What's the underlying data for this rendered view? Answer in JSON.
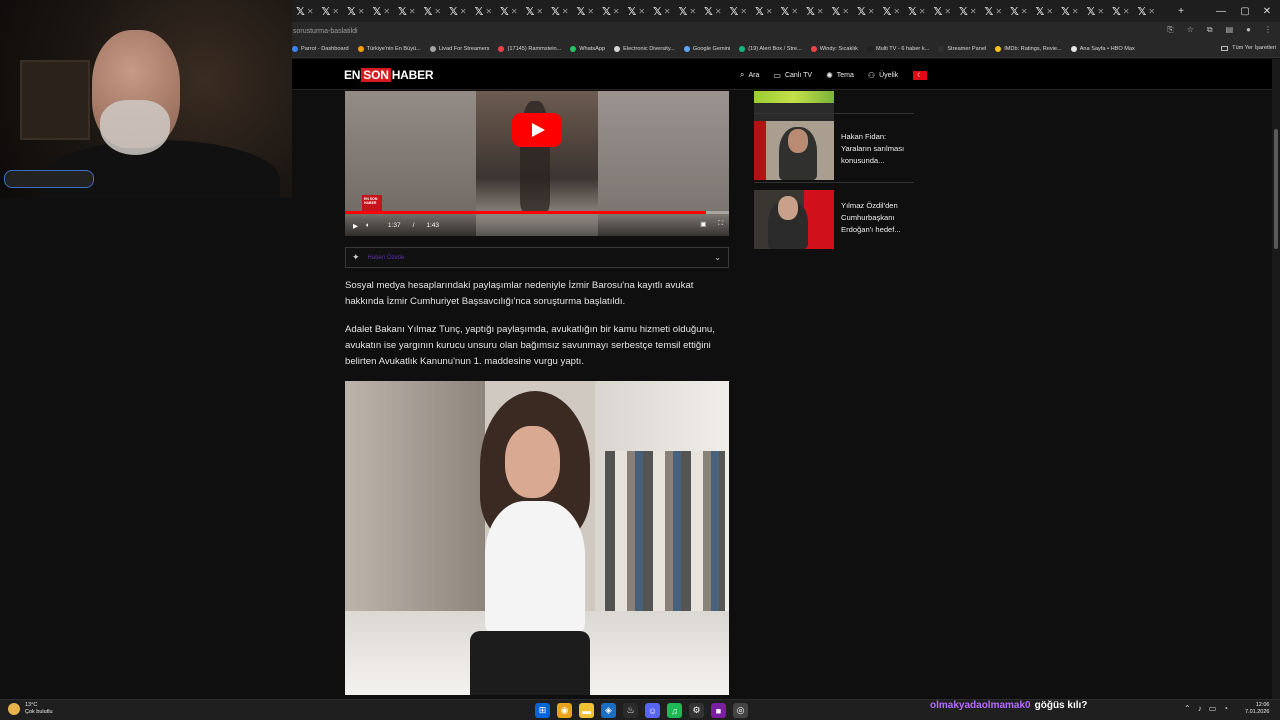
{
  "browser": {
    "tab_count": 34,
    "url_fragment": "sorusturma-baslatildi",
    "bookmarks": [
      {
        "label": "Parrot - Dashboard",
        "color": "#3b82f6"
      },
      {
        "label": "Türkiye'nin En Büyü...",
        "color": "#f59e0b"
      },
      {
        "label": "Livad For Streamers",
        "color": "#a3a3a3"
      },
      {
        "label": "(17145) Rammstein...",
        "color": "#ef4444"
      },
      {
        "label": "WhatsApp",
        "color": "#22c55e"
      },
      {
        "label": "Electronic Diversity...",
        "color": "#d4d4d4"
      },
      {
        "label": "Google Gemini",
        "color": "#60a5fa"
      },
      {
        "label": "(19) Alert Box / Stre...",
        "color": "#10b981"
      },
      {
        "label": "Windy: Sıcaklık",
        "color": "#ef4444"
      },
      {
        "label": "Multi TV - 6 haber k...",
        "color": "#222222"
      },
      {
        "label": "Streamer Panel",
        "color": "#333333"
      },
      {
        "label": "IMDb: Ratings, Revie...",
        "color": "#f5c518"
      },
      {
        "label": "Ana Sayfa • HBO Max",
        "color": "#e5e5e5"
      }
    ],
    "bookmarks_folder": "Tüm Yer İşaretleri"
  },
  "site": {
    "logo_en": "EN",
    "logo_son": "SON",
    "logo_haber": "HABER",
    "nav": [
      {
        "icon": "search-icon",
        "glyph": "⌕",
        "label": "Ara"
      },
      {
        "icon": "tv-icon",
        "glyph": "▭",
        "label": "Canlı TV"
      },
      {
        "icon": "theme-icon",
        "glyph": "✺",
        "label": "Tema"
      },
      {
        "icon": "user-icon",
        "glyph": "⚇",
        "label": "Üyelik"
      }
    ],
    "flag_glyph": "☾"
  },
  "video": {
    "current_time": "1:37",
    "separator": "/",
    "duration": "1:43",
    "progress_fraction": 0.94,
    "badge": "EN SON HABER"
  },
  "summary": {
    "label": "Haberi Özetle"
  },
  "article": {
    "para1": "Sosyal medya hesaplarındaki paylaşımlar nedeniyle İzmir Barosu'na kayıtlı avukat hakkında İzmir Cumhuriyet Başsavcılığı'nca soruşturma başlatıldı.",
    "para2": "Adalet Bakanı Yılmaz Tunç, yaptığı paylaşımda, avukatlığın bir kamu hizmeti olduğunu, avukatın ise yargının kurucu unsuru olan bağımsız savunmayı serbestçe temsil ettiğini belirten Avukatlık Kanunu'nun 1. maddesine vurgu yaptı."
  },
  "sidebar": {
    "items": [
      {
        "title": "Hakan Fidan: Yaraların sarılması konusunda..."
      },
      {
        "title": "Yılmaz Özdil'den Cumhurbaşkanı Erdoğan'ı hedef..."
      }
    ]
  },
  "chat": {
    "user": "olmakyadaolmamak0",
    "message": "göğüs kılı?"
  },
  "taskbar": {
    "weather_temp": "13°C",
    "weather_desc": "Çok bulutlu",
    "time": "12:06",
    "date": "7.01.2026"
  }
}
